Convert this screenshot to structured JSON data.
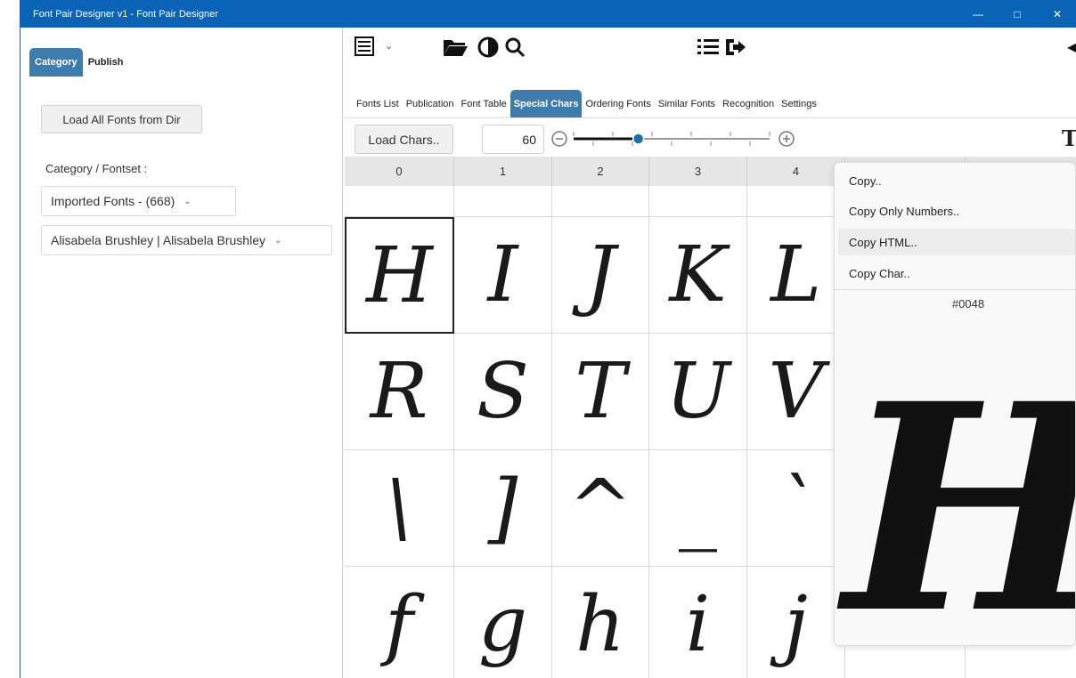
{
  "window": {
    "title": "Font Pair Designer v1 - Font Pair Designer"
  },
  "left": {
    "tabs": [
      "Category",
      "Publish"
    ],
    "load_button": "Load All Fonts from Dir",
    "category_label": "Category / Fontset :",
    "category_value": "Imported Fonts - (668)",
    "font_value": "Alisabela Brushley | Alisabela Brushley"
  },
  "main": {
    "tabs": [
      "Fonts List",
      "Publication",
      "Font Table",
      "Special Chars",
      "Ordering Fonts",
      "Similar Fonts",
      "Recognition",
      "Settings"
    ],
    "load_chars": "Load Chars..",
    "size_value": "60",
    "slider_fraction": 0.33,
    "columns": [
      "0",
      "1",
      "2",
      "3",
      "4"
    ],
    "rows": [
      [
        "",
        "",
        "",
        "",
        ""
      ],
      [
        "H",
        "I",
        "J",
        "K",
        "L"
      ],
      [
        "R",
        "S",
        "T",
        "U",
        "V"
      ],
      [
        "\\",
        "]",
        "^",
        "_",
        "`"
      ],
      [
        "f",
        "g",
        "h",
        "i",
        "j"
      ]
    ]
  },
  "context_menu": {
    "items": [
      "Copy..",
      "Copy Only Numbers..",
      "Copy HTML..",
      "Copy Char.."
    ],
    "code": "#0048",
    "preview_char": "H"
  },
  "colors": {
    "titlebar": "#0b63b8",
    "tab_active": "#3f7cae"
  }
}
